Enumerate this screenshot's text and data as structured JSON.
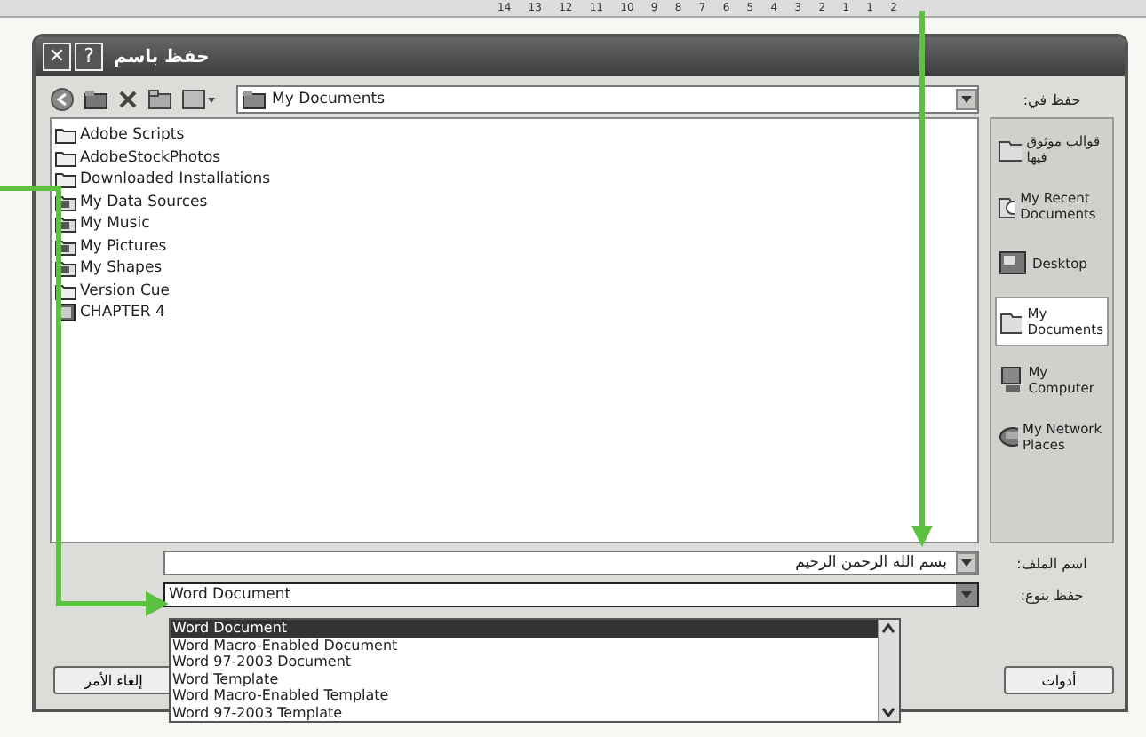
{
  "ruler": {
    "labels": [
      "14",
      "13",
      "12",
      "11",
      "10",
      "9",
      "8",
      "7",
      "6",
      "5",
      "4",
      "3",
      "2",
      "1",
      "1",
      "2"
    ]
  },
  "window": {
    "title": "حفظ باسم",
    "help_button": "?",
    "close_button": "✕"
  },
  "toolbar": {
    "save_in_label": "حفظ في:",
    "location": "My Documents"
  },
  "files": [
    {
      "name": "Adobe Scripts",
      "kind": "folder"
    },
    {
      "name": "AdobeStockPhotos",
      "kind": "folder"
    },
    {
      "name": "Downloaded Installations",
      "kind": "folder"
    },
    {
      "name": "My Data Sources",
      "kind": "special"
    },
    {
      "name": "My Music",
      "kind": "special"
    },
    {
      "name": "My Pictures",
      "kind": "special"
    },
    {
      "name": "My Shapes",
      "kind": "special"
    },
    {
      "name": "Version Cue",
      "kind": "folder"
    },
    {
      "name": "CHAPTER 4",
      "kind": "document"
    }
  ],
  "places": [
    {
      "label": "قوالب موثوق فيها",
      "kind": "folder",
      "selected": false
    },
    {
      "label": "My Recent Documents",
      "kind": "recent",
      "selected": false
    },
    {
      "label": "Desktop",
      "kind": "desktop",
      "selected": false
    },
    {
      "label": "My Documents",
      "kind": "folder",
      "selected": true
    },
    {
      "label": "My Computer",
      "kind": "computer",
      "selected": false
    },
    {
      "label": "My Network Places",
      "kind": "network",
      "selected": false
    }
  ],
  "file_name": {
    "label": "اسم الملف:",
    "value": "بسم الله الرحمن الرحيم"
  },
  "file_type": {
    "label": "حفظ بنوع:",
    "value": "Word Document",
    "expanded": true,
    "options": [
      {
        "label": "Word Document",
        "selected": true
      },
      {
        "label": "Word Macro-Enabled Document",
        "selected": false
      },
      {
        "label": "Word 97-2003 Document",
        "selected": false
      },
      {
        "label": "Word Template",
        "selected": false
      },
      {
        "label": "Word Macro-Enabled Template",
        "selected": false
      },
      {
        "label": "Word 97-2003 Template",
        "selected": false
      }
    ]
  },
  "buttons": {
    "tools": "أدوات",
    "cancel": "إلغاء الأمر"
  }
}
